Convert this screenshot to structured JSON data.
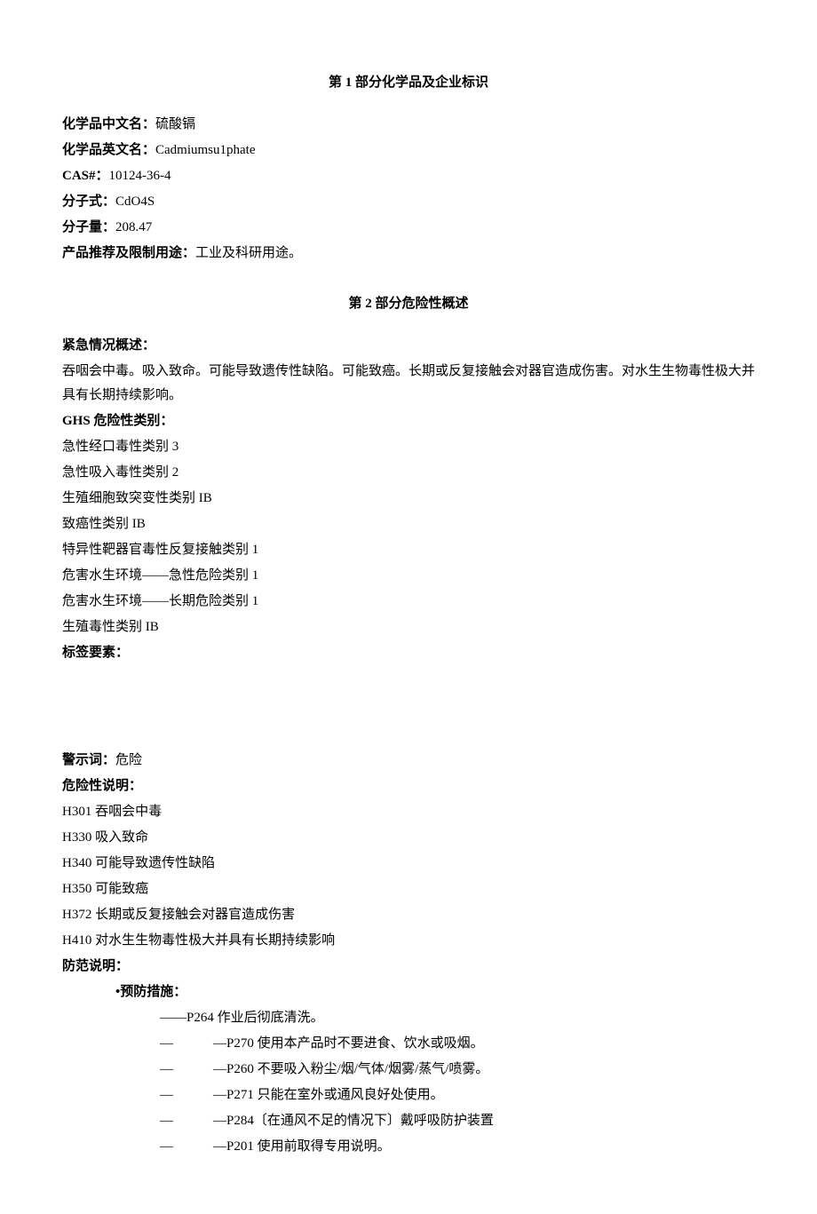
{
  "section1": {
    "title": "第 1 部分化学品及企业标识",
    "fields": {
      "name_cn_label": "化学品中文名：",
      "name_cn_value": "硫酸镉",
      "name_en_label": "化学品英文名：",
      "name_en_value": "Cadmiumsu1phate",
      "cas_label": "CAS#：",
      "cas_value": "10124-36-4",
      "formula_label": "分子式：",
      "formula_value": "CdO4S",
      "mw_label": "分子量：",
      "mw_value": "208.47",
      "use_label": "产品推荐及限制用途：",
      "use_value": "工业及科研用途。"
    }
  },
  "section2": {
    "title": "第 2 部分危险性概述",
    "emergency_label": "紧急情况概述：",
    "emergency_text": "吞咽会中毒。吸入致命。可能导致遗传性缺陷。可能致癌。长期或反复接触会对器官造成伤害。对水生生物毒性极大并具有长期持续影响。",
    "ghs_label": "GHS 危险性类别：",
    "ghs_categories": [
      "急性经口毒性类别 3",
      "急性吸入毒性类别 2",
      "生殖细胞致突变性类别 IB",
      "致癌性类别 IB",
      "特异性靶器官毒性反复接触类别 1",
      "危害水生环境——急性危险类别 1",
      "危害水生环境——长期危险类别 1",
      "生殖毒性类别 IB"
    ],
    "label_elements_label": "标签要素：",
    "signal_label": "警示词：",
    "signal_value": "危险",
    "hazard_stmt_label": "危险性说明：",
    "hazard_statements": [
      "H301 吞咽会中毒",
      "H330 吸入致命",
      "H340 可能导致遗传性缺陷",
      "H350 可能致癌",
      "H372 长期或反复接触会对器官造成伤害",
      "H410 对水生生物毒性极大并具有长期持续影响"
    ],
    "precaution_label": "防范说明：",
    "prevention_label": "•预防措施：",
    "prevention_first": "——P264 作业后彻底清洗。",
    "prevention_items": [
      "—P270 使用本产品时不要进食、饮水或吸烟。",
      "—P260 不要吸入粉尘/烟/气体/烟雾/蒸气/喷雾。",
      "—P271 只能在室外或通风良好处使用。",
      "—P284〔在通风不足的情况下〕戴呼吸防护装置",
      "—P201 使用前取得专用说明。"
    ]
  }
}
